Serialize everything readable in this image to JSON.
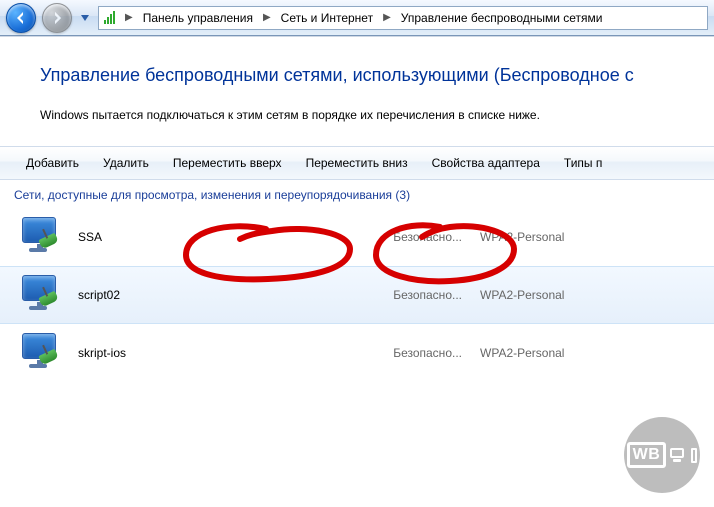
{
  "breadcrumb": {
    "items": [
      {
        "label": "Панель управления"
      },
      {
        "label": "Сеть и Интернет"
      },
      {
        "label": "Управление беспроводными сетями"
      }
    ]
  },
  "page": {
    "title": "Управление беспроводными сетями, использующими (Беспроводное с",
    "description": "Windows пытается подключаться к этим сетям в порядке их перечисления в списке ниже."
  },
  "toolbar": {
    "add": "Добавить",
    "remove": "Удалить",
    "move_up": "Переместить вверх",
    "move_down": "Переместить вниз",
    "adapter_props": "Свойства адаптера",
    "profile_types": "Типы п"
  },
  "group": {
    "header": "Сети, доступные для просмотра, изменения и переупорядочивания (3)",
    "security_label": "Безопасно..."
  },
  "networks": [
    {
      "name": "SSA",
      "security": "WPA2-Personal"
    },
    {
      "name": "script02",
      "security": "WPA2-Personal"
    },
    {
      "name": "skript-ios",
      "security": "WPA2-Personal"
    }
  ],
  "watermark": {
    "text": "WB"
  }
}
